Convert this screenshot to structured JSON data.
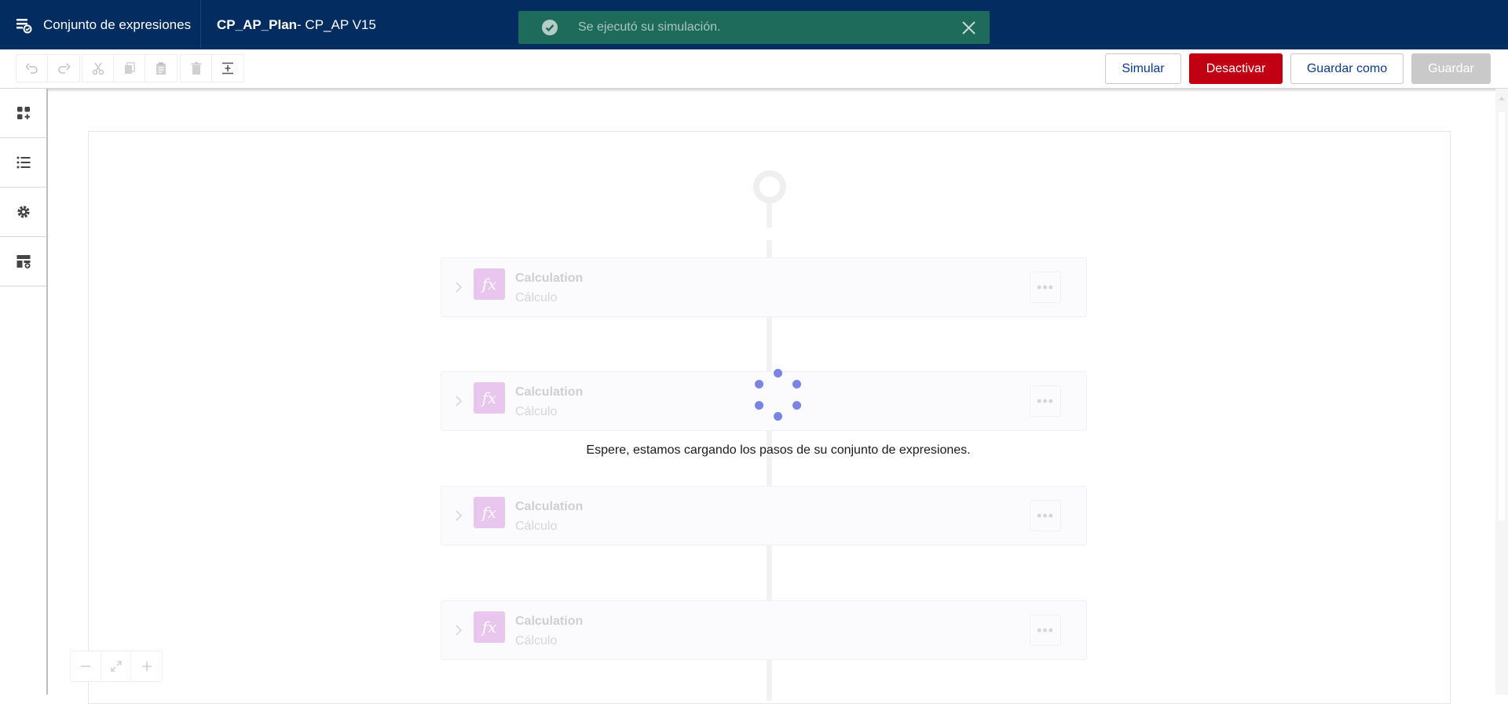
{
  "header": {
    "app_title": "Conjunto de expresiones",
    "doc_name": "CP_AP_Plan",
    "doc_version": " - CP_AP V15",
    "app_icon": "expression-set-icon"
  },
  "toast": {
    "message": "Se ejecutó su simulación.",
    "icon": "check-circle-icon",
    "close_icon": "close-icon"
  },
  "toolbar": {
    "tools": [
      "undo-icon",
      "redo-icon",
      "cut-icon",
      "copy-icon",
      "paste-icon",
      "delete-icon",
      "insert-icon"
    ],
    "simulate_label": "Simular",
    "deactivate_label": "Desactivar",
    "save_as_label": "Guardar como",
    "save_label": "Guardar"
  },
  "sidebar": {
    "items": [
      "components-icon",
      "list-icon",
      "settings-icon",
      "layout-add-icon"
    ]
  },
  "canvas": {
    "steps": [
      {
        "title": "Calculation",
        "subtitle": "Cálculo",
        "icon_text": "fx"
      },
      {
        "title": "Calculation",
        "subtitle": "Cálculo",
        "icon_text": "fx"
      },
      {
        "title": "Calculation",
        "subtitle": "Cálculo",
        "icon_text": "fx"
      },
      {
        "title": "Calculation",
        "subtitle": "Cálculo",
        "icon_text": "fx"
      }
    ],
    "loading_message": "Espere, estamos cargando los pasos de su conjunto de expresiones.",
    "more_label": "•••"
  },
  "colors": {
    "header_bg": "#032d60",
    "toast_bg": "#1e6a5b",
    "danger": "#c20014",
    "accent": "#0b3a8c",
    "spinner": "#7a84e6",
    "fx_tile": "#e9c6ee"
  }
}
